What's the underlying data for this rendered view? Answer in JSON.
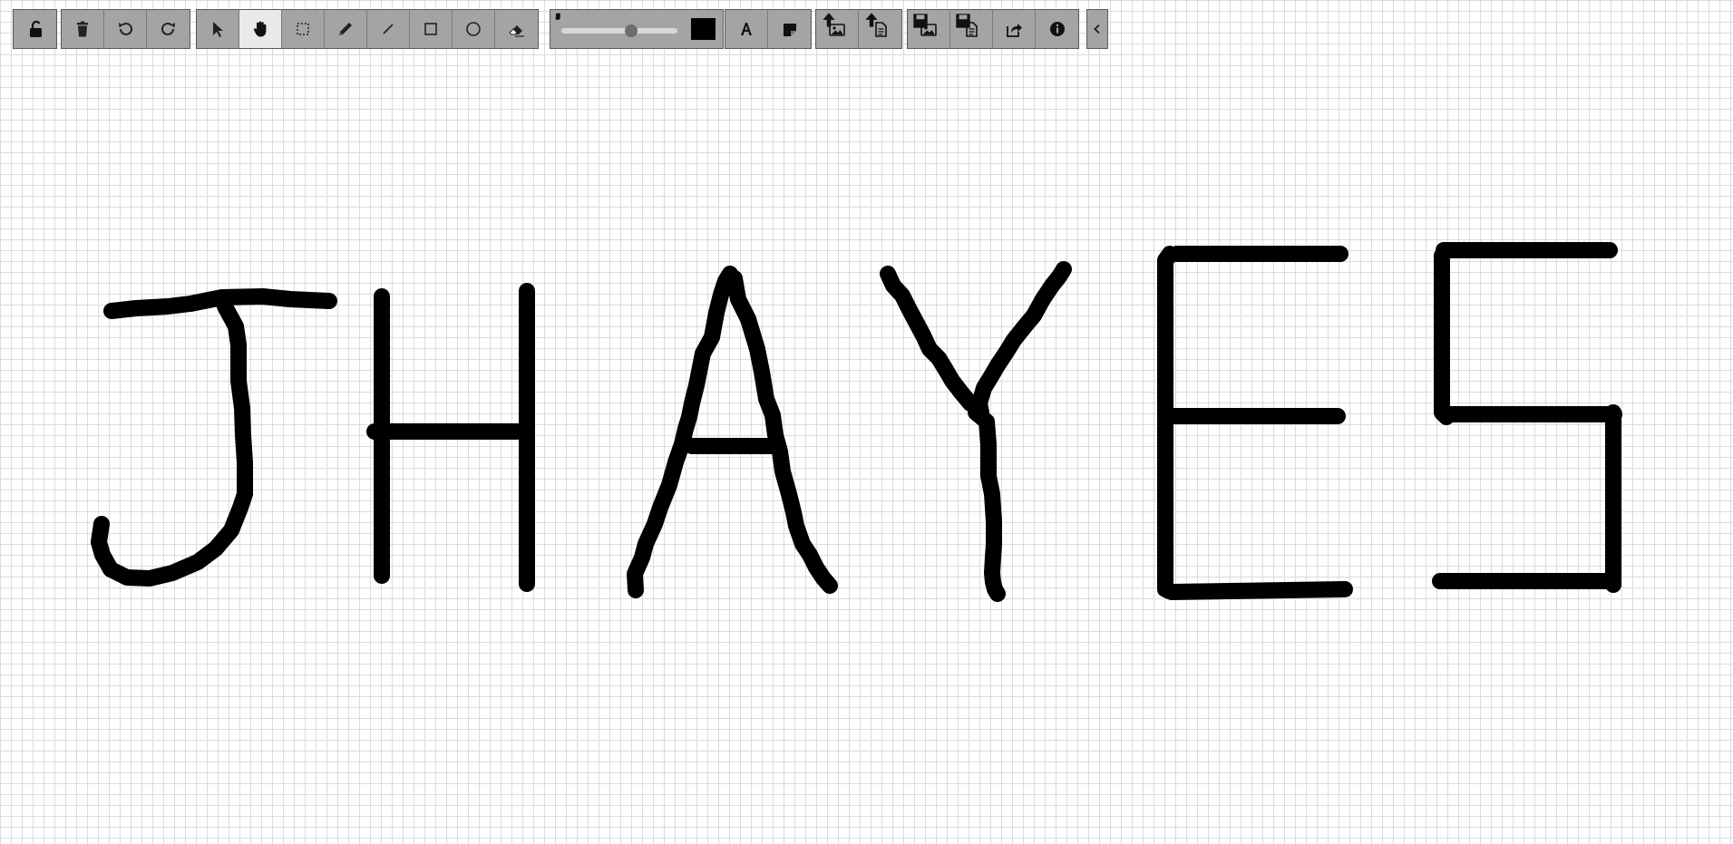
{
  "app": {
    "board_text": "JHAYES"
  },
  "toolbar": {
    "tools": [
      {
        "name": "unlock-icon",
        "active": false
      },
      {
        "name": "trash-icon",
        "active": false
      },
      {
        "name": "undo-icon",
        "active": false
      },
      {
        "name": "redo-icon",
        "active": false
      },
      {
        "name": "pointer-icon",
        "active": false
      },
      {
        "name": "hand-icon",
        "active": true
      },
      {
        "name": "marquee-select-icon",
        "active": false
      },
      {
        "name": "pencil-icon",
        "active": false
      },
      {
        "name": "line-icon",
        "active": false
      },
      {
        "name": "rectangle-icon",
        "active": false
      },
      {
        "name": "circle-icon",
        "active": false
      },
      {
        "name": "eraser-icon",
        "active": false
      },
      {
        "name": "text-icon",
        "active": false
      },
      {
        "name": "sticky-note-icon",
        "active": false
      },
      {
        "name": "upload-image-icon",
        "active": false
      },
      {
        "name": "upload-document-icon",
        "active": false
      },
      {
        "name": "download-image-icon",
        "active": false
      },
      {
        "name": "download-document-icon",
        "active": false
      },
      {
        "name": "share-icon",
        "active": false
      },
      {
        "name": "info-icon",
        "active": false
      },
      {
        "name": "collapse-icon",
        "active": false
      }
    ],
    "stroke_size_level": 0.6,
    "stroke_color": "#000000"
  },
  "colors": {
    "canvas_background": "#ffffff",
    "grid": "#d6dedd",
    "ink": "#000000",
    "toolbar_bg": "#a4a4a4",
    "toolbar_active": "#e9e9e9"
  }
}
